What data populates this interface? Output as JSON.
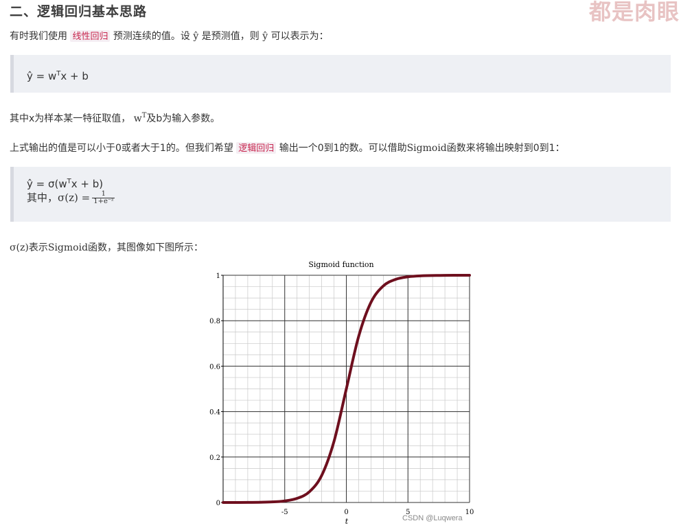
{
  "heading": "二、逻辑回归基本思路",
  "watermark": "都是肉眼",
  "p1": {
    "before": "有时我们使用",
    "link": "线性回归",
    "mid": "预测连续的值。设",
    "sym1": "ŷ",
    "mid2": "是预测值，则",
    "sym2": "ŷ",
    "after": "可以表示为："
  },
  "block1": {
    "pre": "ŷ = w",
    "sup": "T",
    "post": "x + b"
  },
  "p2": {
    "pre": "其中x为样本某一特征取值，",
    "w": "w",
    "sup": "T",
    "post": "及b为输入参数。"
  },
  "p3": {
    "before": "上式输出的值是可以小于0或者大于1的。但我们希望",
    "link": "逻辑回归",
    "mid": "输出一个0到1的数。可以借助",
    "sig": "Sigmoid",
    "after": "函数来将输出映射到0到1："
  },
  "block2": {
    "line1_pre": "ŷ = σ(w",
    "line1_sup": "T",
    "line1_post": "x + b)",
    "line2_pre": "其中，",
    "line2_expr": "σ(z) =",
    "frac_num": "1",
    "frac_den": "1+e⁻ᶻ"
  },
  "p4": {
    "expr": "σ(z)",
    "mid": "表示",
    "sig": "Sigmoid",
    "after": "函数，其图像如下图所示："
  },
  "chart_data": {
    "type": "line",
    "title": "Sigmoid function",
    "xlabel": "t",
    "ylabel": "",
    "xlim": [
      -10,
      10
    ],
    "ylim": [
      0,
      1
    ],
    "x_ticks": [
      -5,
      0,
      5,
      10
    ],
    "x_tick_labels": [
      "-5",
      "0",
      "5",
      "10"
    ],
    "y_ticks": [
      0,
      0.2,
      0.4,
      0.6,
      0.8,
      1
    ],
    "y_tick_labels": [
      "0",
      "0.2",
      "0.4",
      "0.6",
      "0.8",
      "1"
    ],
    "grid": true,
    "series": [
      {
        "color": "#6e0f1e",
        "x": [
          -10,
          -8,
          -6,
          -5,
          -4,
          -3,
          -2,
          -1,
          0,
          1,
          2,
          3,
          4,
          5,
          6,
          8,
          10
        ],
        "y": [
          4.54e-05,
          0.000335,
          0.00247,
          0.0067,
          0.018,
          0.047,
          0.119,
          0.269,
          0.5,
          0.731,
          0.881,
          0.953,
          0.982,
          0.9933,
          0.9975,
          0.99966,
          0.99995
        ]
      }
    ]
  },
  "credit": "CSDN @Luqwera"
}
